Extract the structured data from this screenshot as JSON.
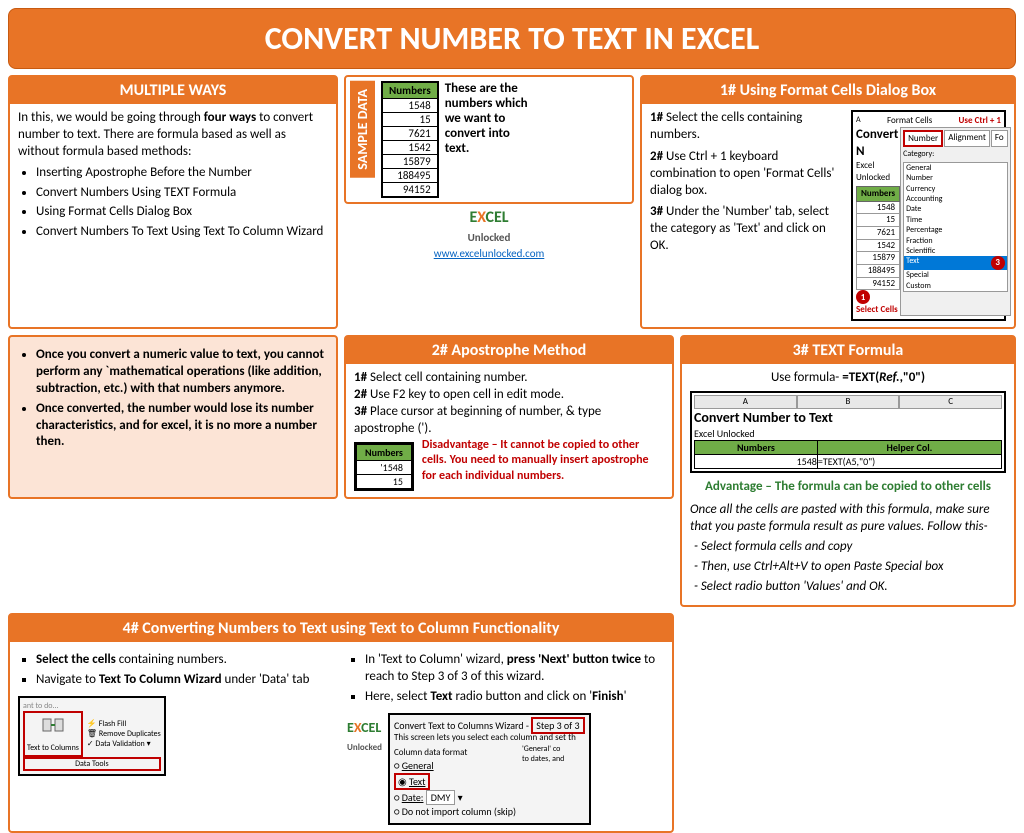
{
  "title": "CONVERT NUMBER TO TEXT IN EXCEL",
  "multipleWays": {
    "header": "MULTIPLE WAYS",
    "intro1": "In this, we would be going through ",
    "introBold": "four ways",
    "intro2": " to convert number to text. There are formula based as well as without formula based methods:",
    "items": [
      "Inserting Apostrophe Before the Number",
      "Convert Numbers Using TEXT Formula",
      "Using Format Cells Dialog Box",
      "Convert Numbers To Text Using Text To Column Wizard"
    ]
  },
  "sample": {
    "label": "SAMPLE DATA",
    "tableHeader": "Numbers",
    "values": [
      "1548",
      "15",
      "7621",
      "1542",
      "15879",
      "188495",
      "94152"
    ],
    "caption": "These are the numbers which we want to convert into text.",
    "logoLink": "www.excelunlocked.com"
  },
  "method1": {
    "header": "1# Using Format Cells Dialog Box",
    "s1b": "1#",
    "s1t": " Select the cells containing numbers.",
    "s2b": "2#",
    "s2t": " Use Ctrl + 1 keyboard combination to open 'Format Cells' dialog box.",
    "s3b": "3#",
    "s3t": " Under the 'Number' tab, select the category as 'Text' and click on OK.",
    "imgTitle": "Convert N",
    "imgSub": "Excel Unlocked",
    "tabFormat": "Format Cells",
    "tabHint": "Use Ctrl + 1",
    "tabs": [
      "Number",
      "Alignment",
      "Fo"
    ],
    "catLabel": "Category:",
    "cats": [
      "General",
      "Number",
      "Currency",
      "Accounting",
      "Date",
      "Time",
      "Percentage",
      "Fraction",
      "Scientific",
      "Text",
      "Special",
      "Custom"
    ],
    "selectCells": "Select Cells",
    "call1": "1",
    "call3": "3"
  },
  "notes": {
    "n1a": "Once you convert a numeric value to text, you cannot perform any `mathematical operations (like addition, subtraction, etc.) with that numbers anymore.",
    "n2a": "Once converted, the number would lose its number characteristics, and for excel, it is no more a number then."
  },
  "method2": {
    "header": "2# Apostrophe Method",
    "s1": "1# ",
    "s1t": "Select cell containing number.",
    "s2": "2# ",
    "s2t": "Use F2 key to open cell in edit mode.",
    "s3": "3# ",
    "s3t": "Place cursor at beginning of number, & type apostrophe (').",
    "imgHeader": "Numbers",
    "imgR1": "'1548",
    "imgR2": "15",
    "disadvantage": "Disadvantage – It cannot be copied to other cells. You need to manually insert apostrophe for each individual numbers."
  },
  "method3": {
    "header": "3# TEXT Formula",
    "formula": "Use formula-  =TEXT(Ref.,\"0\")",
    "imgTitle": "Convert Number to Text",
    "imgSub": "Excel Unlocked",
    "h1": "Numbers",
    "h2": "Helper Col.",
    "r1a": "1548",
    "r1b": "=TEXT(A5,\"0\")",
    "advantage": "Advantage – The formula can be copied to other cells",
    "note": "Once all the cells are pasted with this formula, make sure that you paste formula result as pure values. Follow this-",
    "steps": [
      "Select formula cells and copy",
      "Then, use Ctrl+Alt+V to open Paste Special box",
      "Select radio button 'Values' and OK."
    ]
  },
  "method4": {
    "header": "4# Converting Numbers to Text using Text to Column Functionality",
    "leftItems": [
      {
        "b": "Select the cells",
        "t": " containing numbers."
      },
      {
        "b": "Text To Column Wizard",
        "pre": "Navigate to ",
        "post": " under 'Data' tab"
      }
    ],
    "rightItems": [
      {
        "t1": "In 'Text to Column' wizard, ",
        "b": "press 'Next' button twice",
        "t2": " to reach to Step 3 of 3 of this wizard."
      },
      {
        "t1": "Here, select ",
        "b": "Text",
        "t2": " radio button and click on '",
        "b2": "Finish",
        "t3": "'"
      }
    ],
    "ribbon": {
      "hint": "ant to do...",
      "btn": "Text to Columns",
      "items": [
        "Flash Fill",
        "Remove Duplicates",
        "Data Validation"
      ],
      "section": "Data Tools"
    },
    "wizard": {
      "title": "Convert Text to Columns Wizard - ",
      "step": "Step 3 of 3",
      "desc": "This screen lets you select each column and set th",
      "colLabel": "Column data format",
      "opts": [
        "General",
        "Text",
        "Date:",
        "Do not import column (skip)"
      ],
      "dateVal": "DMY",
      "hint": "'General' co\nto dates, and"
    }
  }
}
